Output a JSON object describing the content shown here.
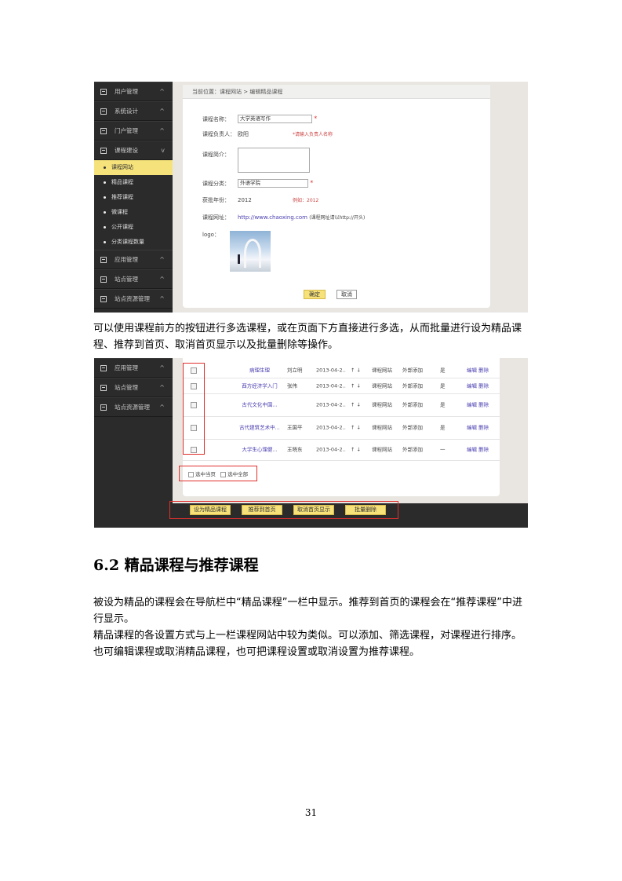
{
  "shot1": {
    "sidebar": {
      "items_top": [
        {
          "label": "用户管理"
        },
        {
          "label": "系统设计"
        },
        {
          "label": "门户管理"
        },
        {
          "label": "课程建设"
        }
      ],
      "sub_items": [
        {
          "label": "课程网站",
          "active": true
        },
        {
          "label": "精品课程",
          "active": false
        },
        {
          "label": "推荐课程",
          "active": false
        },
        {
          "label": "微课程",
          "active": false
        },
        {
          "label": "公开课程",
          "active": false
        },
        {
          "label": "分类课程数量",
          "active": false
        }
      ],
      "items_bottom": [
        {
          "label": "应用管理"
        },
        {
          "label": "站点管理"
        },
        {
          "label": "站点资源管理"
        }
      ]
    },
    "breadcrumb": "当前位置：课程网站 > 编辑精品课程",
    "form": {
      "name_label": "课程名称：",
      "name_value": "大学英语写作",
      "teacher_label": "课程负责人：",
      "teacher_value": "欧阳",
      "teacher_hint": "*请输入负责人名称",
      "intro_label": "课程简介：",
      "category_label": "课程分类：",
      "category_value": "外语学院",
      "year_label": "获批年份：",
      "year_value": "2012",
      "year_hint": "例如：2012",
      "url_label": "课程网址：",
      "url_value": "http://www.chaoxing.com",
      "url_hint": "(课程网址请以http://开头)",
      "logo_label": "logo：",
      "confirm": "确定",
      "cancel": "取消"
    }
  },
  "para1": "可以使用课程前方的按钮进行多选课程，或在页面下方直接进行多选，从而批量进行设为精品课程、推荐到首页、取消首页显示以及批量删除等操作。",
  "shot2": {
    "sidebar": [
      {
        "label": "应用管理"
      },
      {
        "label": "站点管理"
      },
      {
        "label": "站点资源管理"
      }
    ],
    "rows": [
      {
        "title": "病理生理",
        "teacher": "刘立明",
        "date": "2013-04-2..",
        "arrows": "↑ ↓",
        "type": "课程网站",
        "source": "外部添加",
        "flag": "是",
        "ops": "编辑 删除"
      },
      {
        "title": "西方经济学入门",
        "teacher": "张伟",
        "date": "2013-04-2..",
        "arrows": "↑ ↓",
        "type": "课程网站",
        "source": "外部添加",
        "flag": "是",
        "ops": "编辑 删除"
      },
      {
        "title": "古代文化中国...",
        "teacher": "",
        "date": "2013-04-2..",
        "arrows": "↑ ↓",
        "type": "课程网站",
        "source": "外部添加",
        "flag": "是",
        "ops": "编辑 删除"
      },
      {
        "title": "古代建筑艺术中...",
        "teacher": "王国平",
        "date": "2013-04-2..",
        "arrows": "↑ ↓",
        "type": "课程网站",
        "source": "外部添加",
        "flag": "是",
        "ops": "编辑 删除"
      },
      {
        "title": "大学生心理健...",
        "teacher": "王晓东",
        "date": "2013-04-2..",
        "arrows": "↑ ↓",
        "type": "课程网站",
        "source": "外部添加",
        "flag": "一",
        "ops": "编辑 删除"
      }
    ],
    "select_page": "选中当页",
    "select_all": "选中全部",
    "buttons": [
      "设为精品课程",
      "推荐到首页",
      "取消首页显示",
      "批量删除"
    ]
  },
  "heading": "6.2 精品课程与推荐课程",
  "para2": "被设为精品的课程会在导航栏中“精品课程”一栏中显示。推荐到首页的课程会在“推荐课程”中进行显示。",
  "para3": "精品课程的各设置方式与上一栏课程网站中较为类似。可以添加、筛选课程，对课程进行排序。也可编辑课程或取消精品课程，也可把课程设置或取消设置为推荐课程。",
  "page_number": "31",
  "colors": {
    "sidebar_bg": "#2c2b2b",
    "accent_yellow": "#f7e27a",
    "highlight_red": "#e0302d",
    "link": "#4a3fb0"
  }
}
